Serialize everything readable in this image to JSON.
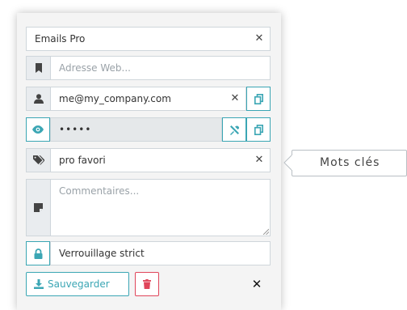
{
  "form": {
    "title_value": "Emails Pro",
    "url_placeholder": "Adresse Web...",
    "login_value": "me@my_company.com",
    "password_value": "•••••",
    "tags_value": "pro favori",
    "comments_placeholder": "Commentaires...",
    "lock_label": "Verrouillage strict",
    "save_label": "Sauvegarder",
    "clear_glyph": "✕",
    "close_glyph": "✕"
  },
  "tooltip": {
    "text": "Mots clés"
  },
  "colors": {
    "accent": "#3ba6b4",
    "danger": "#e0455a",
    "addon_bg": "#e9ecef",
    "panel_bg": "#f4f4f4",
    "border": "#cfd6db"
  },
  "icons": [
    "bookmark-icon",
    "user-icon",
    "eye-icon",
    "tags-icon",
    "sticky-note-icon",
    "lock-icon",
    "copy-icon",
    "tools-icon",
    "download-icon",
    "trash-icon",
    "close-icon"
  ]
}
